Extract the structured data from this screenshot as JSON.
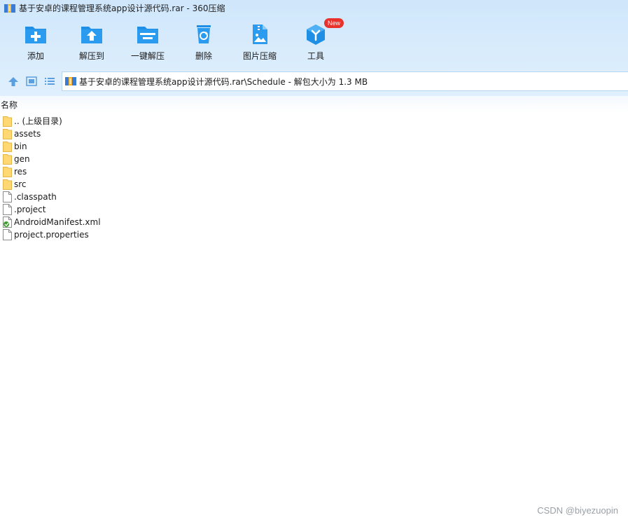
{
  "window": {
    "title": "基于安卓的课程管理系统app设计源代码.rar - 360压缩"
  },
  "toolbar": {
    "items": [
      {
        "label": "添加",
        "icon": "add-folder-icon"
      },
      {
        "label": "解压到",
        "icon": "extract-to-icon"
      },
      {
        "label": "一键解压",
        "icon": "one-click-extract-icon"
      },
      {
        "label": "删除",
        "icon": "recycle-delete-icon"
      },
      {
        "label": "图片压缩",
        "icon": "image-compress-icon"
      },
      {
        "label": "工具",
        "icon": "tools-cube-icon",
        "badge": "New"
      }
    ]
  },
  "address": {
    "path": "基于安卓的课程管理系统app设计源代码.rar\\Schedule - 解包大小为 1.3 MB"
  },
  "list": {
    "column_name": "名称",
    "items": [
      {
        "name": ".. (上级目录)",
        "type": "folder"
      },
      {
        "name": "assets",
        "type": "folder"
      },
      {
        "name": "bin",
        "type": "folder"
      },
      {
        "name": "gen",
        "type": "folder"
      },
      {
        "name": "res",
        "type": "folder"
      },
      {
        "name": "src",
        "type": "folder"
      },
      {
        "name": ".classpath",
        "type": "file"
      },
      {
        "name": ".project",
        "type": "file"
      },
      {
        "name": "AndroidManifest.xml",
        "type": "xml"
      },
      {
        "name": "project.properties",
        "type": "file"
      }
    ]
  },
  "watermark": "CSDN @biyezuopin",
  "colors": {
    "accent": "#1f8fe6",
    "folder": "#ffd873",
    "badge": "#e8322b"
  }
}
